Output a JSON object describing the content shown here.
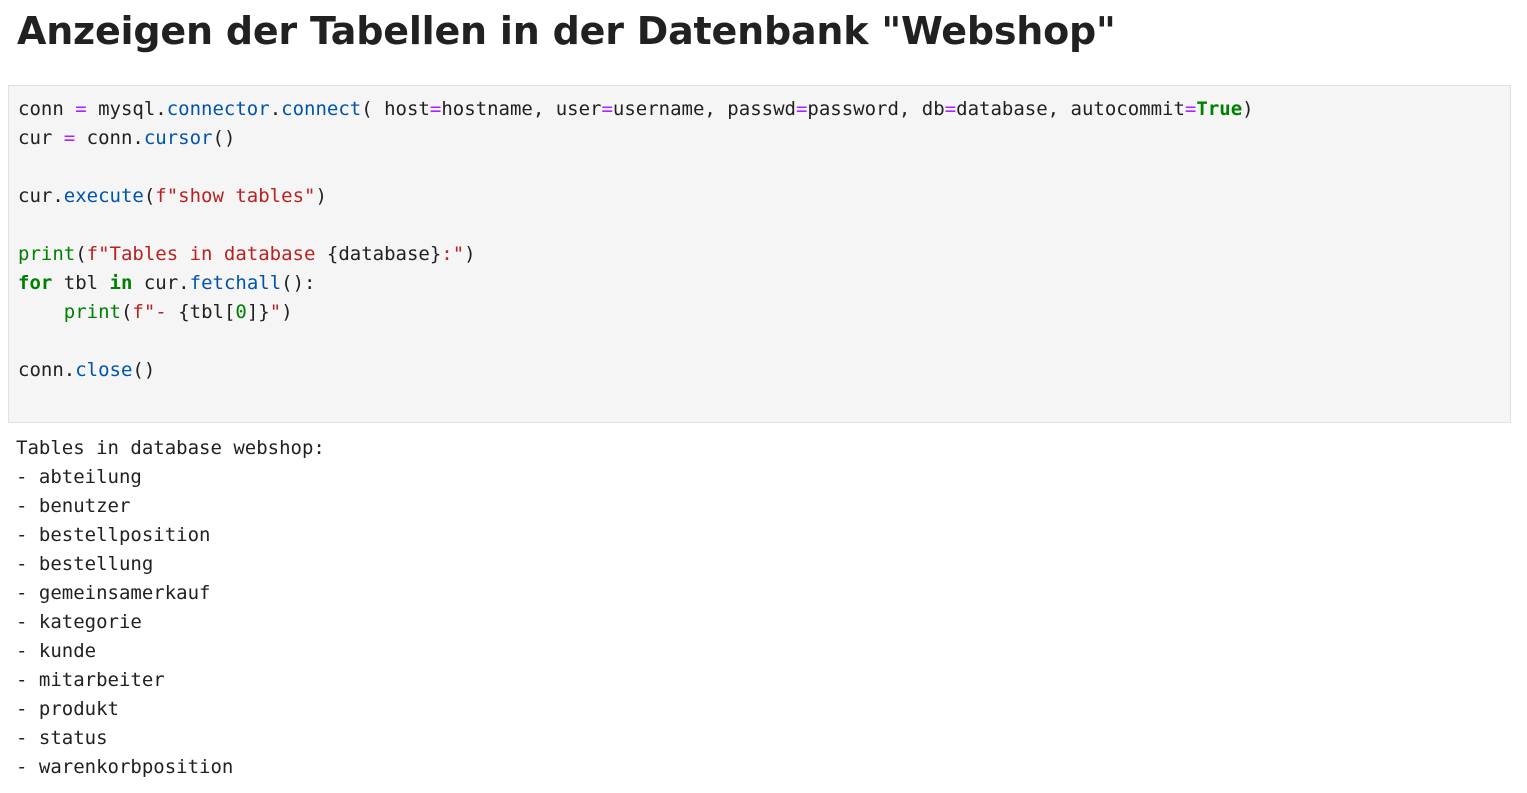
{
  "heading": "Anzeigen der Tabellen in der Datenbank \"Webshop\"",
  "code_lines": [
    [
      {
        "t": "conn ",
        "c": "plain"
      },
      {
        "t": "=",
        "c": "op"
      },
      {
        "t": " mysql.",
        "c": "plain"
      },
      {
        "t": "connector",
        "c": "fn"
      },
      {
        "t": ".",
        "c": "plain"
      },
      {
        "t": "connect",
        "c": "fn"
      },
      {
        "t": "( host",
        "c": "plain"
      },
      {
        "t": "=",
        "c": "op"
      },
      {
        "t": "hostname, user",
        "c": "plain"
      },
      {
        "t": "=",
        "c": "op"
      },
      {
        "t": "username, passwd",
        "c": "plain"
      },
      {
        "t": "=",
        "c": "op"
      },
      {
        "t": "password, db",
        "c": "plain"
      },
      {
        "t": "=",
        "c": "op"
      },
      {
        "t": "database, autocommit",
        "c": "plain"
      },
      {
        "t": "=",
        "c": "op"
      },
      {
        "t": "True",
        "c": "kw"
      },
      {
        "t": ")",
        "c": "plain"
      }
    ],
    [
      {
        "t": "cur ",
        "c": "plain"
      },
      {
        "t": "=",
        "c": "op"
      },
      {
        "t": " conn.",
        "c": "plain"
      },
      {
        "t": "cursor",
        "c": "fn"
      },
      {
        "t": "()",
        "c": "plain"
      }
    ],
    [],
    [
      {
        "t": "cur.",
        "c": "plain"
      },
      {
        "t": "execute",
        "c": "fn"
      },
      {
        "t": "(",
        "c": "plain"
      },
      {
        "t": "f\"show tables\"",
        "c": "str"
      },
      {
        "t": ")",
        "c": "plain"
      }
    ],
    [],
    [
      {
        "t": "print",
        "c": "bi"
      },
      {
        "t": "(",
        "c": "plain"
      },
      {
        "t": "f\"Tables in database ",
        "c": "str"
      },
      {
        "t": "{database}",
        "c": "plain"
      },
      {
        "t": ":\"",
        "c": "str"
      },
      {
        "t": ")",
        "c": "plain"
      }
    ],
    [
      {
        "t": "for",
        "c": "kw"
      },
      {
        "t": " tbl ",
        "c": "plain"
      },
      {
        "t": "in",
        "c": "kw"
      },
      {
        "t": " cur.",
        "c": "plain"
      },
      {
        "t": "fetchall",
        "c": "fn"
      },
      {
        "t": "():",
        "c": "plain"
      }
    ],
    [
      {
        "t": "    ",
        "c": "plain"
      },
      {
        "t": "print",
        "c": "bi"
      },
      {
        "t": "(",
        "c": "plain"
      },
      {
        "t": "f\"- ",
        "c": "str"
      },
      {
        "t": "{tbl[",
        "c": "plain"
      },
      {
        "t": "0",
        "c": "num"
      },
      {
        "t": "]}",
        "c": "plain"
      },
      {
        "t": "\"",
        "c": "str"
      },
      {
        "t": ")",
        "c": "plain"
      }
    ],
    [],
    [
      {
        "t": "conn.",
        "c": "plain"
      },
      {
        "t": "close",
        "c": "fn"
      },
      {
        "t": "()",
        "c": "plain"
      }
    ]
  ],
  "output_lines": [
    "Tables in database webshop:",
    "- abteilung",
    "- benutzer",
    "- bestellposition",
    "- bestellung",
    "- gemeinsamerkauf",
    "- kategorie",
    "- kunde",
    "- mitarbeiter",
    "- produkt",
    "- status",
    "- warenkorbposition"
  ]
}
